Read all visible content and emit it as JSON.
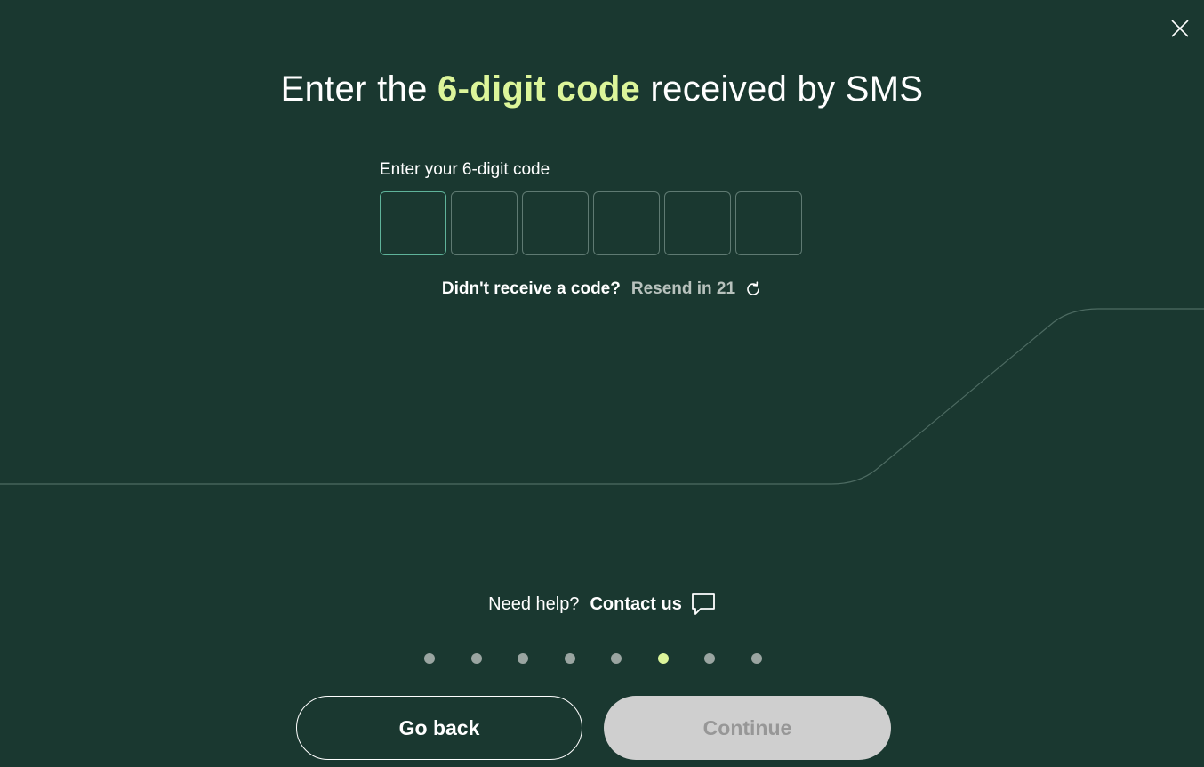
{
  "dialog": {
    "close_label": "Close"
  },
  "headline": {
    "prefix": "Enter the ",
    "highlight": "6-digit code",
    "suffix": " received by SMS"
  },
  "code_entry": {
    "label": "Enter your 6-digit code",
    "digits": [
      "",
      "",
      "",
      "",
      "",
      ""
    ]
  },
  "resend": {
    "question": "Didn't receive a code?",
    "link_label": "Resend in 21"
  },
  "help": {
    "question": "Need help?",
    "contact_label": "Contact us"
  },
  "progress": {
    "total_steps": 8,
    "current_step": 6
  },
  "actions": {
    "back_label": "Go back",
    "continue_label": "Continue",
    "continue_enabled": false
  },
  "colors": {
    "background": "#1a3830",
    "accent": "#dcf59a",
    "text": "#ffffff",
    "muted_text": "#b8c2bd",
    "inactive_dot": "#9aa5a1",
    "disabled_button": "#cfcfcf",
    "focus_border": "#5fb39a"
  },
  "icons": {
    "close": "close-icon",
    "resend": "refresh-icon",
    "contact": "chat-bubble-icon"
  }
}
